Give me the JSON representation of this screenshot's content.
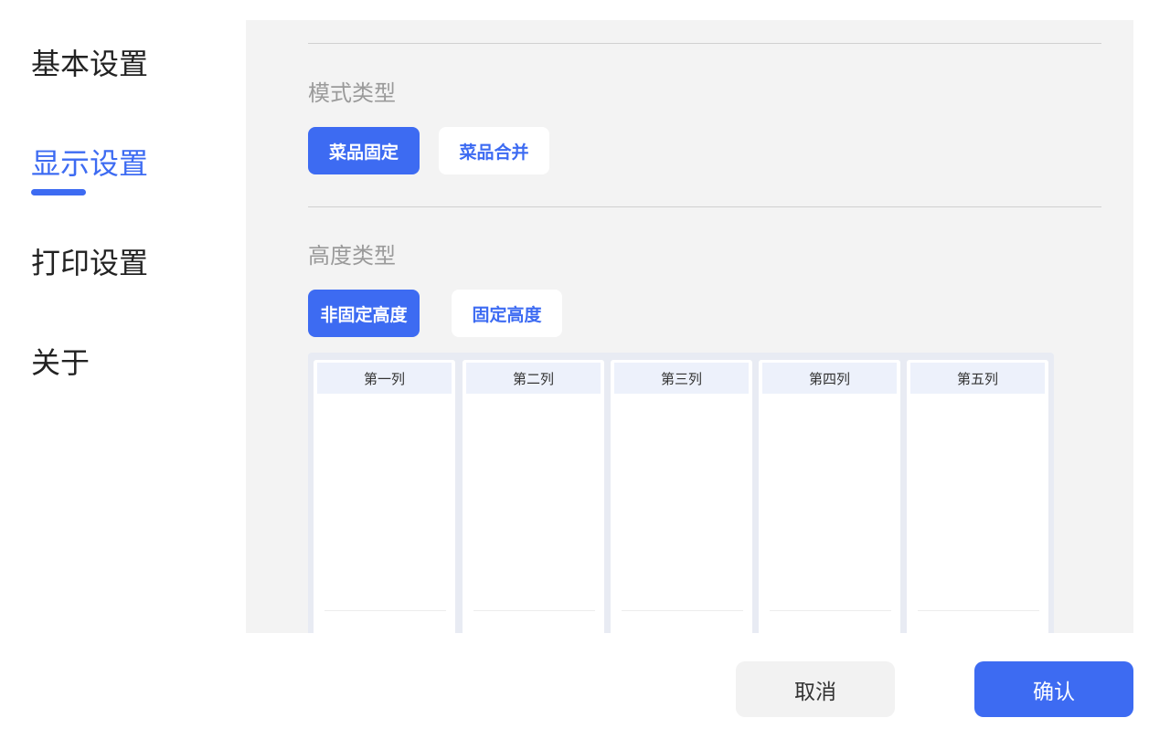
{
  "sidebar": {
    "items": [
      {
        "label": "基本设置",
        "active": false
      },
      {
        "label": "显示设置",
        "active": true
      },
      {
        "label": "打印设置",
        "active": false
      },
      {
        "label": "关于",
        "active": false
      }
    ]
  },
  "display": {
    "mode_type": {
      "label": "模式类型",
      "options": [
        "菜品固定",
        "菜品合并"
      ],
      "selected": "菜品固定"
    },
    "height_type": {
      "label": "高度类型",
      "options": [
        "非固定高度",
        "固定高度"
      ],
      "selected": "非固定高度"
    },
    "preview_columns": [
      "第一列",
      "第二列",
      "第三列",
      "第四列",
      "第五列"
    ]
  },
  "footer": {
    "cancel_label": "取消",
    "confirm_label": "确认"
  },
  "colors": {
    "accent": "#3d6bf2",
    "panel_bg": "#f3f3f3",
    "column_header_bg": "#edf1fb"
  }
}
